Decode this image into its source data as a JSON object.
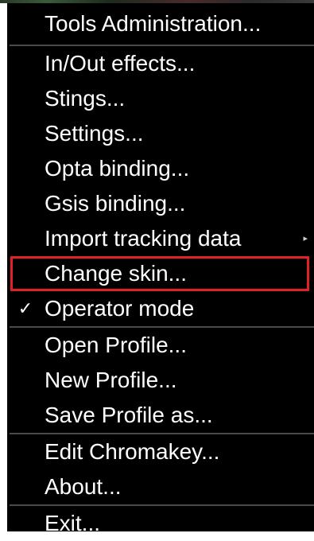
{
  "menu": {
    "groups": [
      [
        {
          "label": "Tools Administration...",
          "checked": false,
          "submenu": false
        }
      ],
      [
        {
          "label": "In/Out effects...",
          "checked": false,
          "submenu": false
        },
        {
          "label": "Stings...",
          "checked": false,
          "submenu": false
        },
        {
          "label": "Settings...",
          "checked": false,
          "submenu": false
        },
        {
          "label": "Opta binding...",
          "checked": false,
          "submenu": false
        },
        {
          "label": "Gsis binding...",
          "checked": false,
          "submenu": false
        },
        {
          "label": "Import tracking data",
          "checked": false,
          "submenu": true
        },
        {
          "label": "Change skin...",
          "checked": false,
          "submenu": false,
          "highlighted": true
        },
        {
          "label": "Operator mode",
          "checked": true,
          "submenu": false
        }
      ],
      [
        {
          "label": "Open Profile...",
          "checked": false,
          "submenu": false
        },
        {
          "label": "New Profile...",
          "checked": false,
          "submenu": false
        },
        {
          "label": "Save Profile as...",
          "checked": false,
          "submenu": false
        }
      ],
      [
        {
          "label": "Edit Chromakey...",
          "checked": false,
          "submenu": false
        },
        {
          "label": "About...",
          "checked": false,
          "submenu": false
        }
      ],
      [
        {
          "label": "Exit...",
          "checked": false,
          "submenu": false
        }
      ]
    ],
    "check_glyph": "✓",
    "submenu_glyph": "▸",
    "highlight_color": "#e0202a",
    "background_color": "#000000",
    "text_color": "#ffffff"
  }
}
